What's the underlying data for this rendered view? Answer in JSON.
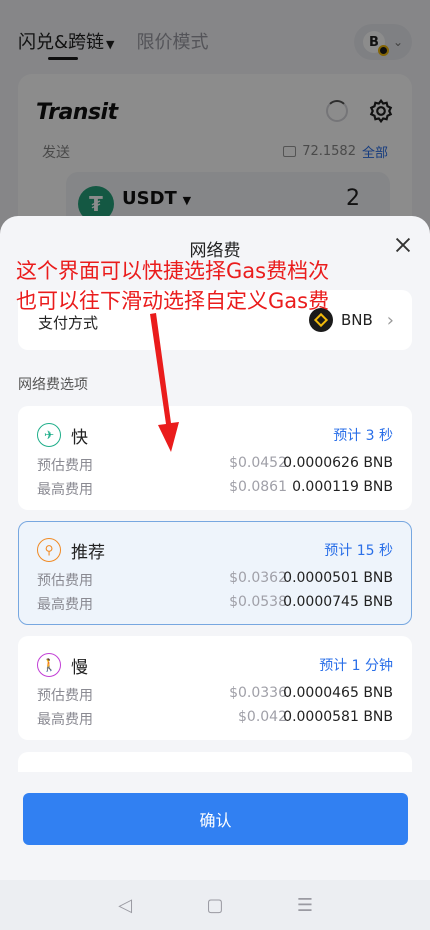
{
  "background": {
    "tabs": [
      {
        "label": "闪兑&跨链"
      },
      {
        "label": "限价模式"
      }
    ],
    "chain_letter": "B",
    "brand": "Transit",
    "send_label": "发送",
    "balance": "72.1582",
    "all_label": "全部",
    "token": {
      "symbol": "USDT",
      "amount": "2"
    }
  },
  "sheet": {
    "title": "网络费",
    "annotation": {
      "line1": "这个界面可以快捷选择Gas费档次",
      "line2": "也可以往下滑动选择自定义Gas费"
    },
    "payment": {
      "label": "支付方式",
      "coin": "BNB"
    },
    "options_title": "网络费选项",
    "options": [
      {
        "name": "快",
        "eta": "预计 3 秒",
        "est_label": "预估费用",
        "est_usd": "$0.0452",
        "est_bnb": "0.0000626 BNB",
        "max_label": "最高费用",
        "max_usd": "$0.0861",
        "max_bnb": "0.000119 BNB",
        "selected": false
      },
      {
        "name": "推荐",
        "eta": "预计 15 秒",
        "est_label": "预估费用",
        "est_usd": "$0.0362",
        "est_bnb": "0.0000501 BNB",
        "max_label": "最高费用",
        "max_usd": "$0.0538",
        "max_bnb": "0.0000745 BNB",
        "selected": true
      },
      {
        "name": "慢",
        "eta": "预计 1 分钟",
        "est_label": "预估费用",
        "est_usd": "$0.0336",
        "est_bnb": "0.0000465 BNB",
        "max_label": "最高费用",
        "max_usd": "$0.042",
        "max_bnb": "0.0000581 BNB",
        "selected": false
      }
    ],
    "confirm_label": "确认"
  },
  "colors": {
    "accent": "#3180f2",
    "annotation": "#ea1c1c",
    "fast_icon": "#1fae8a",
    "recommended_icon": "#f08a24",
    "slow_icon": "#c23fd6"
  }
}
